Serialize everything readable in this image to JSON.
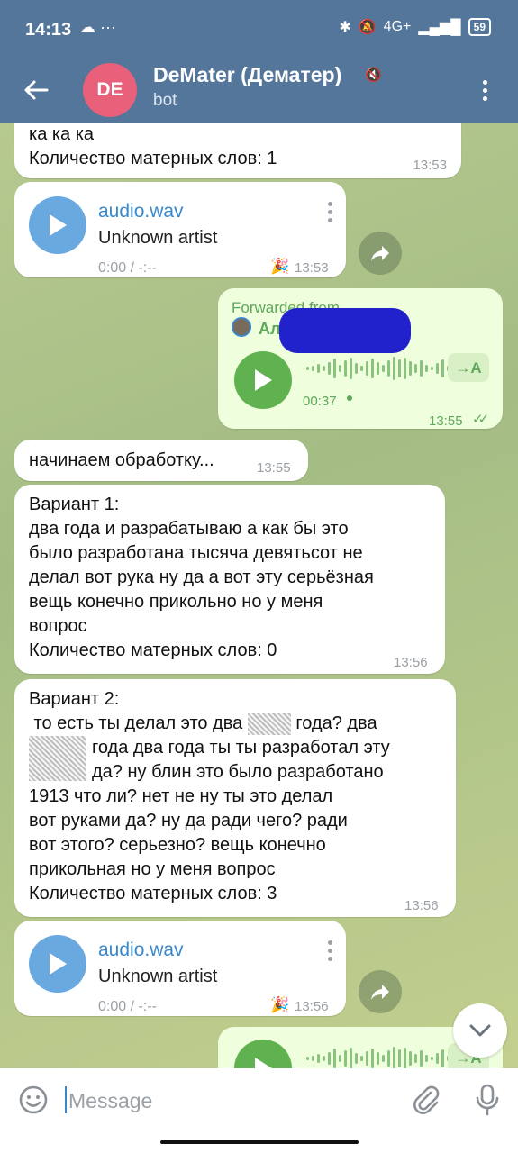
{
  "status_bar": {
    "time": "14:13",
    "left_icons": "☁ ···",
    "network": "4G+",
    "battery": "59"
  },
  "header": {
    "avatar_initials": "DE",
    "title": "DeMater (Дематер)",
    "subtitle": "bot"
  },
  "messages": {
    "m1": {
      "line1": "ка ка ка",
      "line2": "Количество матерных слов: 1",
      "time": "13:53"
    },
    "audio1": {
      "title": "audio.wav",
      "artist": "Unknown artist",
      "duration": "0:00 / -:--",
      "time": "13:53",
      "reaction": "🎉"
    },
    "voice": {
      "forwarded_label": "Forwarded from",
      "sender_prefix": "Ал",
      "duration": "00:37",
      "transcribe": "→A",
      "time": "13:55",
      "status": "✓✓"
    },
    "m2": {
      "text": "начинаем обработку...",
      "time": "13:55"
    },
    "m3": {
      "text": "Вариант 1:\nдва года и разрабатываю а как бы это\nбыло разработана тысяча девятьсот не\nделал вот рука ну да а вот эту серьёзная\nвещь конечно прикольно но у меня\nвопрос\nКоличество матерных слов: 0",
      "time": "13:56"
    },
    "m4": {
      "line1": "Вариант 2:",
      "line2_a": " то есть ты делал это два",
      "line2_b": "года? два",
      "line3": "года два года ты ты разработал эту",
      "line4": "да? ну блин это было разработано",
      "rest": "1913 что ли? нет не ну ты это делал\nвот руками да? ну да ради чего? ради\nвот этого? серьезно? вещь конечно\nприкольная но у меня вопрос\nКоличество матерных слов: 3",
      "time": "13:56"
    },
    "audio2": {
      "title": "audio.wav",
      "artist": "Unknown artist",
      "duration": "0:00 / -:--",
      "time": "13:56",
      "reaction": "🎉"
    },
    "voice2": {
      "transcribe": "→A"
    }
  },
  "input": {
    "placeholder": "Message"
  },
  "colors": {
    "header_bg": "#54769a",
    "outgoing_bubble": "#effedd",
    "incoming_bubble": "#ffffff",
    "accent_blue": "#3a88cc",
    "accent_green": "#5fa85a",
    "avatar_bg": "#e8607a"
  }
}
